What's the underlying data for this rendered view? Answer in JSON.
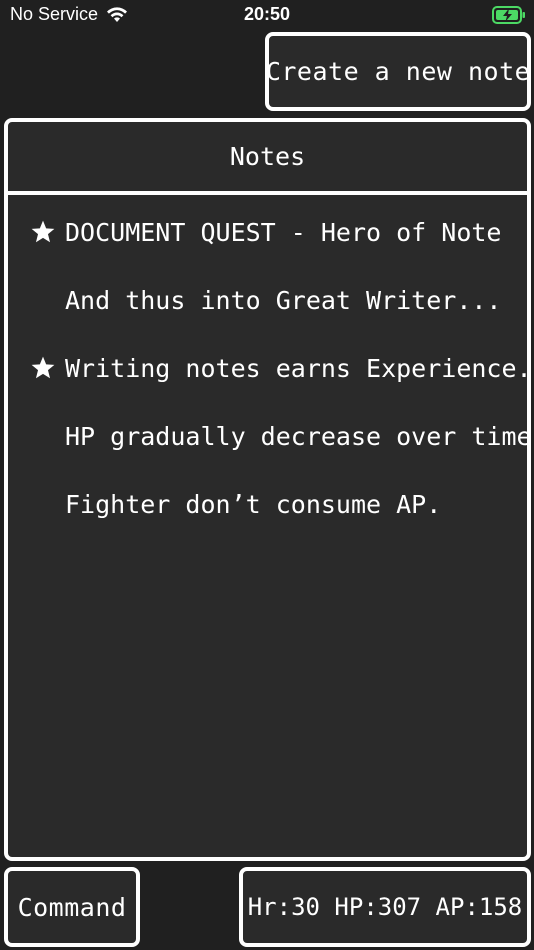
{
  "status_bar": {
    "carrier": "No Service",
    "time": "20:50",
    "icons": [
      "wifi-icon",
      "battery-charging-icon"
    ]
  },
  "toolbar": {
    "create_label": "Create a new note"
  },
  "notes": {
    "title": "Notes",
    "items": [
      {
        "text": "DOCUMENT QUEST - Hero of Note",
        "starred": true
      },
      {
        "text": "And thus into Great Writer...",
        "starred": false
      },
      {
        "text": "Writing notes earns Experience.",
        "starred": true
      },
      {
        "text": "HP gradually decrease over time.",
        "starred": false
      },
      {
        "text": "Fighter don’t consume AP.",
        "starred": false
      }
    ]
  },
  "footer": {
    "command_label": "Command",
    "stats": "Hr:30 HP:307 AP:158"
  },
  "colors": {
    "background": "#202020",
    "panel": "#2a2a2a",
    "border": "#ffffff",
    "battery_accent": "#4cd964"
  }
}
